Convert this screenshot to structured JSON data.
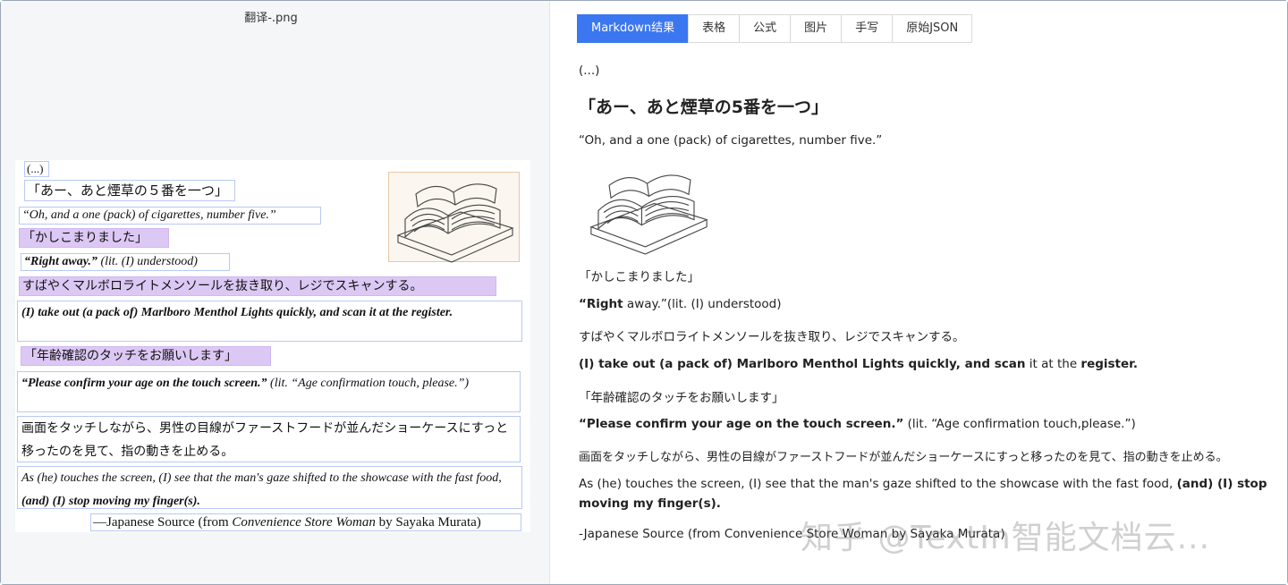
{
  "left": {
    "file_title": "翻译-.png",
    "doc": {
      "l1": "(...)",
      "l2": "「あー、あと煙草の５番を一つ」",
      "l3": "“Oh, and a one (pack) of cigarettes, number five.”",
      "l4": "「かしこまりました」",
      "l5_bold": "“Right away.”",
      "l5_rest": " (lit. (I) understood)",
      "l6": "すばやくマルボロライトメンソールを抜き取り、レジでスキャンする。",
      "l7": "(I) take out (a pack of) Marlboro Menthol Lights quickly, and scan it at the register.",
      "l8": "「年齢確認のタッチをお願いします」",
      "l9_bold": "“Please confirm your age on the touch screen.”",
      "l9_rest": " (lit. “Age confirmation touch, please.”)",
      "l10": "画面をタッチしながら、男性の目線がファーストフードが並んだショーケースにすっと移ったのを見て、指の動きを止める。",
      "l11_it": "As (he) touches the screen, (I) see that the man's gaze shifted to the showcase with the fast food,",
      "l11_bold": " (and) (I) stop moving my finger(s).",
      "l12_a": "—Japanese Source (from ",
      "l12_it": "Convenience Store Woman",
      "l12_b": " by Sayaka Murata)"
    }
  },
  "tabs": [
    "Markdown结果",
    "表格",
    "公式",
    "图片",
    "手写",
    "原始JSON"
  ],
  "active_tab": "Markdown结果",
  "markdown": {
    "l1": "(...)",
    "h1": "「あー、あと煙草の5番を一つ」",
    "p1": "“Oh, and a one (pack) of cigarettes, number five.”",
    "p2": "「かしこまりました」",
    "p3_bold": "“Right",
    "p3_rest": " away.”(lit. (I) understood)",
    "p4": "すばやくマルボロライトメンソールを抜き取り、レジでスキャンする。",
    "p5_bold": "(I) take out (a pack of) Marlboro Menthol Lights quickly, and scan",
    "p5_mid": " it at the ",
    "p5_bold2": "register.",
    "p6": "「年齢確認のタッチをお願いします」",
    "p7_bold": "“Please confirm your age on the touch screen.”",
    "p7_rest": " (lit. “Age confirmation touch,please.”)",
    "p8": "画面をタッチしながら、男性の目線がファーストフードが並んだショーケースにすっと移ったのを見て、指の動きを止める。",
    "p9_rest": "As (he) touches the screen, (I) see that the man's gaze shifted to the showcase with the fast food, ",
    "p9_bold": "(and) (I) stop moving my finger(s).",
    "p10": "-Japanese Source (from Convenience Store Woman by Sayaka Murata)"
  },
  "watermark": "知乎 @TextIn智能文档云..."
}
